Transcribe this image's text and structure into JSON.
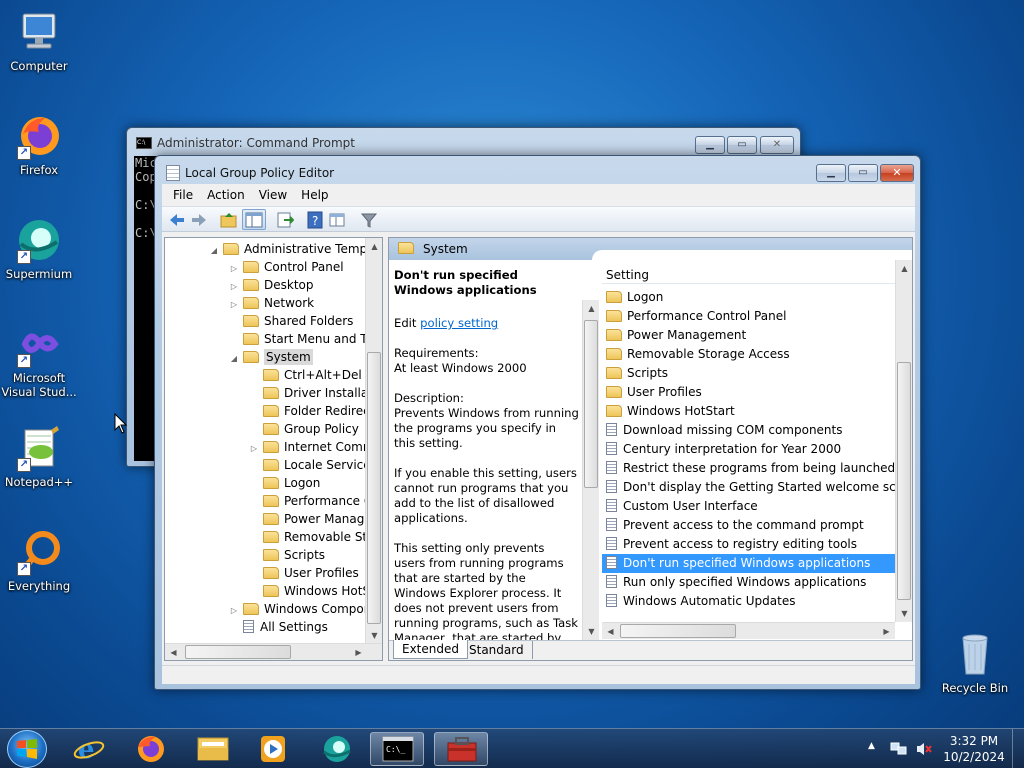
{
  "desktop": {
    "icons": [
      {
        "label": "Computer"
      },
      {
        "label": "Firefox"
      },
      {
        "label": "Supermium"
      },
      {
        "label": "Microsoft Visual Stud..."
      },
      {
        "label": "Notepad++"
      },
      {
        "label": "Everything"
      },
      {
        "label": "Recycle Bin"
      }
    ]
  },
  "cmd_window": {
    "title": "Administrator: Command Prompt",
    "lines": [
      "Mic",
      "Cop",
      "",
      "C:\\",
      "",
      "C:\\"
    ]
  },
  "gpedit": {
    "title": "Local Group Policy Editor",
    "menu": [
      "File",
      "Action",
      "View",
      "Help"
    ],
    "tree": [
      {
        "label": "Administrative Templates",
        "indent": 0,
        "expander": "open"
      },
      {
        "label": "Control Panel",
        "indent": 1,
        "expander": "closed"
      },
      {
        "label": "Desktop",
        "indent": 1,
        "expander": "closed"
      },
      {
        "label": "Network",
        "indent": 1,
        "expander": "closed"
      },
      {
        "label": "Shared Folders",
        "indent": 1,
        "expander": "none"
      },
      {
        "label": "Start Menu and Taskbar",
        "indent": 1,
        "expander": "none"
      },
      {
        "label": "System",
        "indent": 1,
        "expander": "open",
        "selected": true
      },
      {
        "label": "Ctrl+Alt+Del Options",
        "indent": 2,
        "expander": "none"
      },
      {
        "label": "Driver Installation",
        "indent": 2,
        "expander": "none"
      },
      {
        "label": "Folder Redirection",
        "indent": 2,
        "expander": "none"
      },
      {
        "label": "Group Policy",
        "indent": 2,
        "expander": "none"
      },
      {
        "label": "Internet Communication Management",
        "indent": 2,
        "expander": "closed"
      },
      {
        "label": "Locale Services",
        "indent": 2,
        "expander": "none"
      },
      {
        "label": "Logon",
        "indent": 2,
        "expander": "none"
      },
      {
        "label": "Performance Control Panel",
        "indent": 2,
        "expander": "none"
      },
      {
        "label": "Power Management",
        "indent": 2,
        "expander": "none"
      },
      {
        "label": "Removable Storage Access",
        "indent": 2,
        "expander": "none"
      },
      {
        "label": "Scripts",
        "indent": 2,
        "expander": "none"
      },
      {
        "label": "User Profiles",
        "indent": 2,
        "expander": "none"
      },
      {
        "label": "Windows HotStart",
        "indent": 2,
        "expander": "none"
      },
      {
        "label": "Windows Components",
        "indent": 1,
        "expander": "closed"
      },
      {
        "label": "All Settings",
        "indent": 1,
        "expander": "none",
        "icon": "policy"
      }
    ],
    "header_title": "System",
    "description": {
      "title": "Don't run specified Windows applications",
      "edit_prefix": "Edit",
      "edit_link": "policy setting",
      "requirements_label": "Requirements:",
      "requirements_value": "At least Windows 2000",
      "description_label": "Description:",
      "description_text": "Prevents Windows from running the programs you specify in this setting.",
      "para2": "If you enable this setting, users cannot run programs that you add to the list of disallowed applications.",
      "para3": "This setting only prevents users from running programs that are started by the Windows Explorer process. It does not prevent users from running programs, such as Task Manager, that are started by the system process or by other"
    },
    "list_header": "Setting",
    "list": [
      {
        "label": "Logon",
        "type": "folder"
      },
      {
        "label": "Performance Control Panel",
        "type": "folder"
      },
      {
        "label": "Power Management",
        "type": "folder"
      },
      {
        "label": "Removable Storage Access",
        "type": "folder"
      },
      {
        "label": "Scripts",
        "type": "folder"
      },
      {
        "label": "User Profiles",
        "type": "folder"
      },
      {
        "label": "Windows HotStart",
        "type": "folder"
      },
      {
        "label": "Download missing COM components",
        "type": "policy"
      },
      {
        "label": "Century interpretation for Year 2000",
        "type": "policy"
      },
      {
        "label": "Restrict these programs from being launched from Help",
        "type": "policy"
      },
      {
        "label": "Don't display the Getting Started welcome screen at logon",
        "type": "policy"
      },
      {
        "label": "Custom User Interface",
        "type": "policy"
      },
      {
        "label": "Prevent access to the command prompt",
        "type": "policy"
      },
      {
        "label": "Prevent access to registry editing tools",
        "type": "policy"
      },
      {
        "label": "Don't run specified Windows applications",
        "type": "policy",
        "selected": true
      },
      {
        "label": "Run only specified Windows applications",
        "type": "policy"
      },
      {
        "label": "Windows Automatic Updates",
        "type": "policy"
      }
    ],
    "tabs": [
      {
        "label": "Extended",
        "active": true
      },
      {
        "label": "Standard",
        "active": false
      }
    ]
  },
  "taskbar": {
    "time": "3:32 PM",
    "date": "10/2/2024"
  },
  "colors": {
    "selection": "#3399ff",
    "link": "#0066cc",
    "header_blue": "#a9c3de"
  }
}
